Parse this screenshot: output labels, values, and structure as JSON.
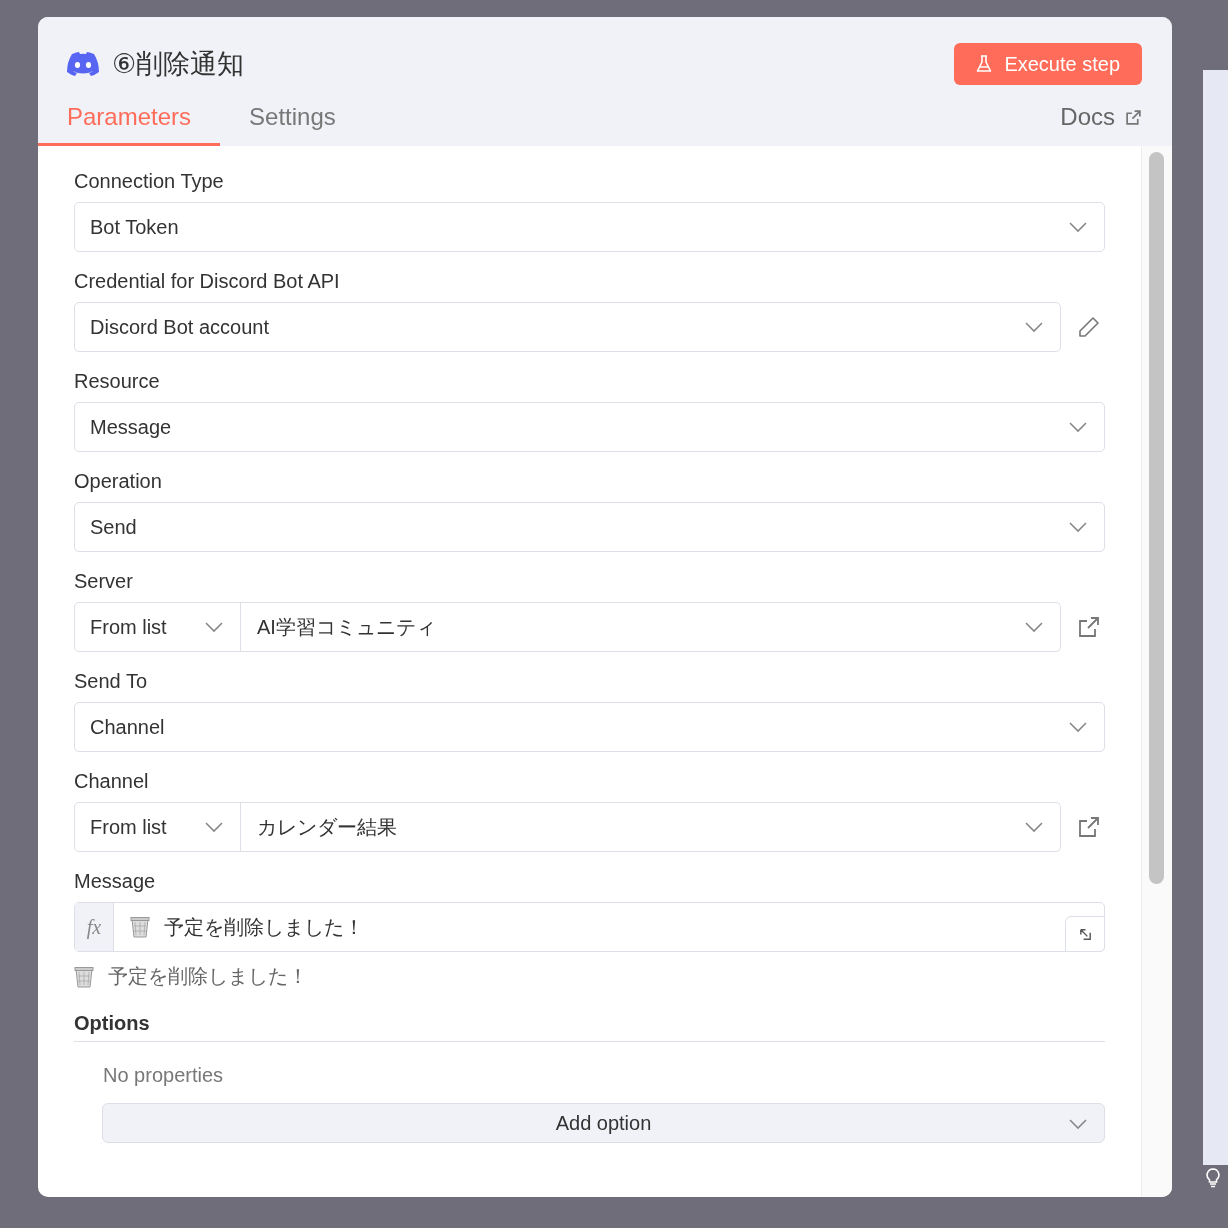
{
  "node": {
    "title": "⑥削除通知"
  },
  "execute_button": "Execute step",
  "tabs": [
    {
      "label": "Parameters",
      "selected": true
    },
    {
      "label": "Settings",
      "selected": false
    }
  ],
  "docs_link": "Docs",
  "fields": [
    {
      "kind": "select",
      "label": "Connection Type",
      "value": "Bot Token"
    },
    {
      "kind": "credential",
      "label": "Credential for Discord Bot API",
      "value": "Discord Bot account"
    },
    {
      "kind": "select",
      "label": "Resource",
      "value": "Message"
    },
    {
      "kind": "select",
      "label": "Operation",
      "value": "Send"
    },
    {
      "kind": "locator",
      "label": "Server",
      "mode": "From list",
      "value": "AI学習コミュニティ"
    },
    {
      "kind": "select",
      "label": "Send To",
      "value": "Channel"
    },
    {
      "kind": "locator",
      "label": "Channel",
      "mode": "From list",
      "value": "カレンダー結果"
    },
    {
      "kind": "expression",
      "label": "Message",
      "marker": "fx",
      "value": "予定を削除しました！",
      "preview": "予定を削除しました！"
    }
  ],
  "options": {
    "title": "Options",
    "empty_text": "No properties",
    "add_button": "Add option"
  }
}
